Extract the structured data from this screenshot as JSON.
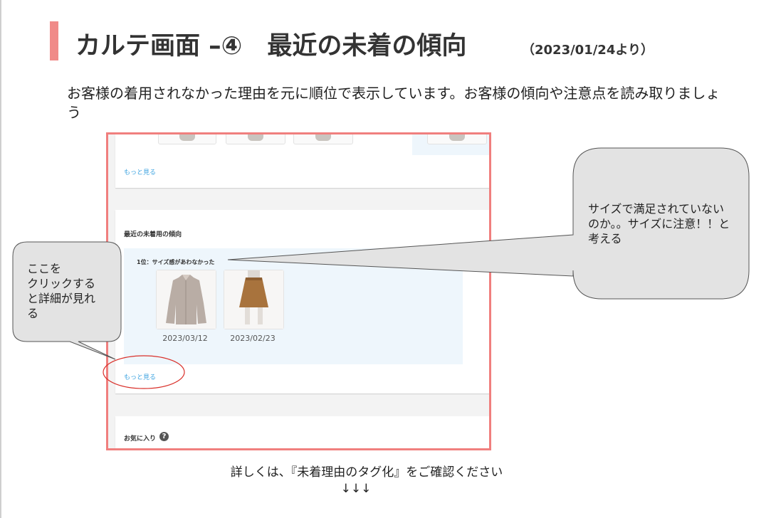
{
  "slide": {
    "title": "カルテ画面 –④　最近の未着の傾向",
    "title_date": "（2023/01/24より）",
    "description": "お客様の着用されなかった理由を元に順位で表示しています。お客様の傾向や注意点を読み取りましょう",
    "bottom_note": "詳しくは、『未着理由のタグ化』をご確認ください",
    "bottom_arrows": "↓↓↓",
    "accent_color": "#f08a88"
  },
  "screenshot": {
    "top_more_link": "もっと見る",
    "section_title": "最近の未着用の傾向",
    "rank_label": "1位：サイズ感があわなかった",
    "items": [
      {
        "date": "2023/03/12",
        "icon": "shirt-thumbnail"
      },
      {
        "date": "2023/02/23",
        "icon": "skirt-thumbnail"
      }
    ],
    "more_link": "もっと見る",
    "favorites_title": "お気に入り",
    "help_icon": "?"
  },
  "callouts": {
    "left": "ここを\nクリックする\nと詳細が見れ\nる",
    "right": "サイズで満足されていないのか。。サイズに注意！！と考える"
  }
}
